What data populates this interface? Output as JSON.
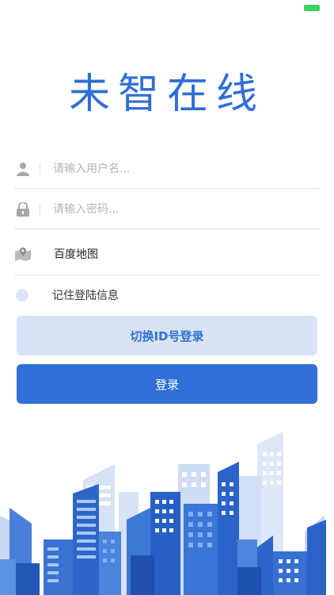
{
  "app": {
    "logo_text": "未智在线"
  },
  "form": {
    "username_placeholder": "请输入用户名...",
    "password_placeholder": "请输入密码...",
    "map_value": "百度地图",
    "remember_label": "记住登陆信息"
  },
  "buttons": {
    "switch_label": "切换ID号登录",
    "login_label": "登录"
  },
  "colors": {
    "accent": "#2f6fd6",
    "light_accent": "#d9e3f7",
    "status_battery": "#3bd15f"
  },
  "icons": {
    "user": "user-icon",
    "lock": "lock-icon",
    "map": "map-pin-icon"
  }
}
